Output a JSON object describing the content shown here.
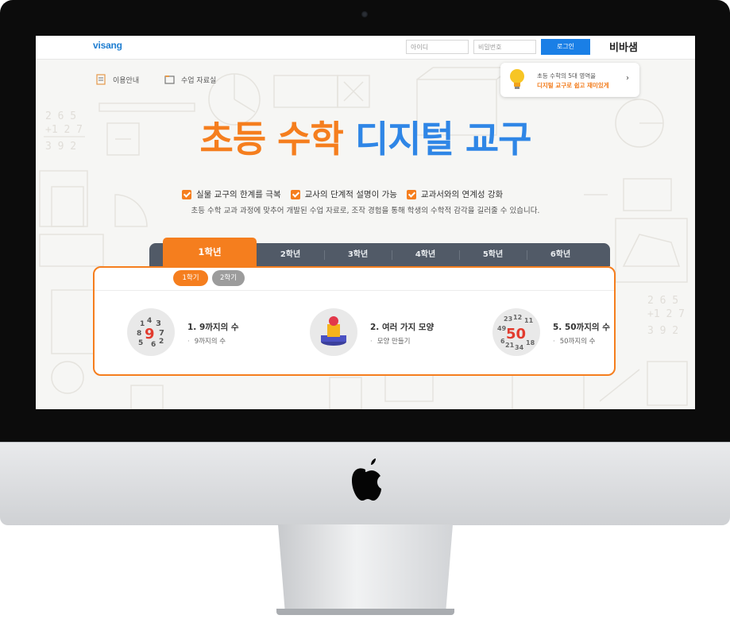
{
  "header": {
    "logo": "visang",
    "id_placeholder": "아이디",
    "pw_placeholder": "비밀번호",
    "login_label": "로그인",
    "brand": "비바샘"
  },
  "quick_links": [
    {
      "label": "이용안내",
      "icon": "document-icon"
    },
    {
      "label": "수업 자료실",
      "icon": "folder-icon"
    }
  ],
  "promo": {
    "line1": "초등 수학의 5대 영역을",
    "line2": "디지털 교구로 쉽고 재미있게",
    "arrow": "›"
  },
  "hero": {
    "title_orange": "초등 수학",
    "title_blue": "디지털 교구",
    "features": [
      "실물 교구의 한계를 극복",
      "교사의 단계적 설명이 가능",
      "교과서와의 연계성 강화"
    ],
    "description": "초등 수학 교과 과정에 맞추어 개발된 수업 자료로, 조작 경험을 통해 학생의 수학적 감각을 길러줄 수 있습니다."
  },
  "grades": [
    "1학년",
    "2학년",
    "3학년",
    "4학년",
    "5학년",
    "6학년"
  ],
  "active_grade": "1학년",
  "semesters": [
    "1학기",
    "2학기"
  ],
  "active_semester": "1학기",
  "units": [
    {
      "title": "1. 9까지의 수",
      "sub": "9까지의 수",
      "icon": "numbers-9-icon"
    },
    {
      "title": "2. 여러 가지 모양",
      "sub": "모양 만들기",
      "icon": "shapes-icon"
    },
    {
      "title": "5. 50까지의 수",
      "sub": "50까지의 수",
      "icon": "numbers-50-icon"
    }
  ],
  "colors": {
    "accent_orange": "#f57e1e",
    "accent_blue": "#2f86e6",
    "tab_bar": "#515a67",
    "login_blue": "#1a7fe6"
  }
}
